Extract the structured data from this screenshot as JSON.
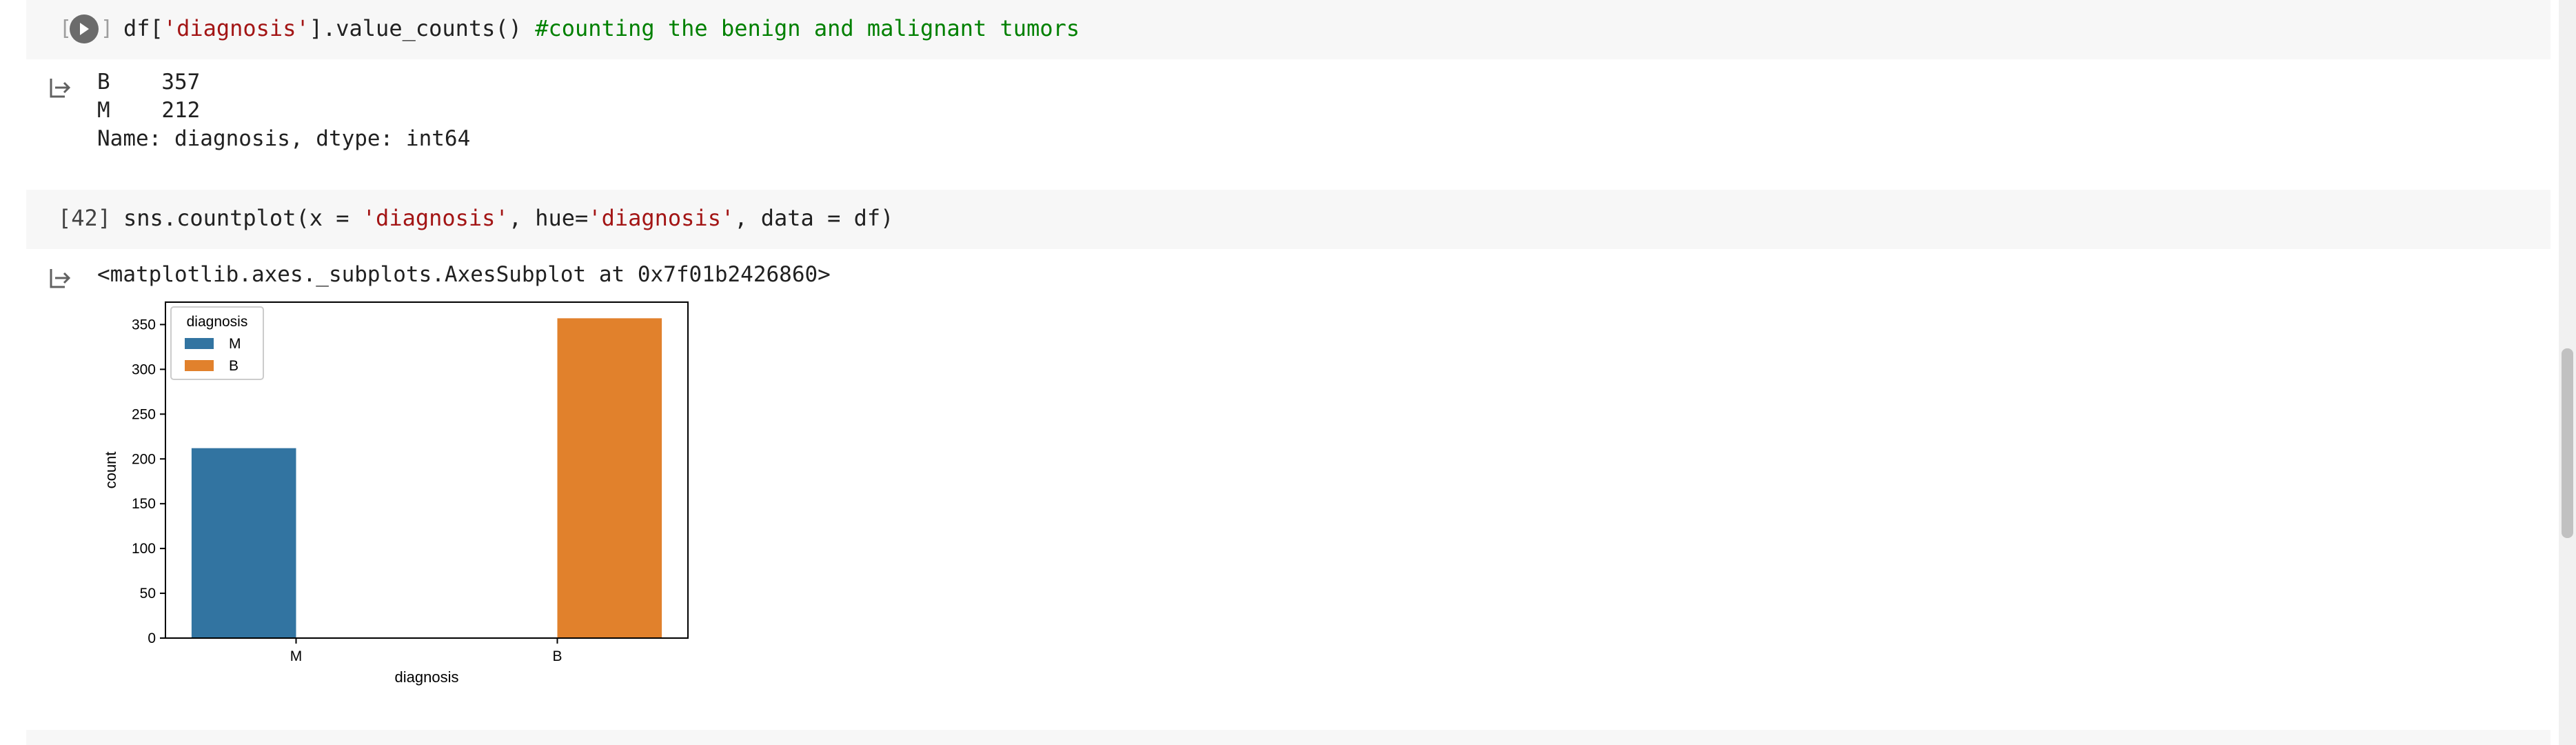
{
  "cell1": {
    "code_tokens": [
      {
        "t": "df[",
        "c": "plain"
      },
      {
        "t": "'diagnosis'",
        "c": "str"
      },
      {
        "t": "].value_counts() ",
        "c": "plain"
      },
      {
        "t": "#counting the benign and malignant tumors",
        "c": "com"
      }
    ],
    "output_lines": [
      "B    357",
      "M    212",
      "Name: diagnosis, dtype: int64"
    ]
  },
  "cell2": {
    "exec_count": "[42]",
    "code_tokens": [
      {
        "t": "sns.countplot(x = ",
        "c": "plain"
      },
      {
        "t": "'diagnosis'",
        "c": "str"
      },
      {
        "t": ", hue=",
        "c": "plain"
      },
      {
        "t": "'diagnosis'",
        "c": "str"
      },
      {
        "t": ", data = df)",
        "c": "plain"
      }
    ],
    "output_repr": "<matplotlib.axes._subplots.AxesSubplot at 0x7f01b2426860>"
  },
  "colors": {
    "series_m": "#3274a1",
    "series_b": "#e1812c",
    "string": "#a31515",
    "comment": "#008000"
  },
  "chart_data": {
    "type": "bar",
    "categories": [
      "M",
      "B"
    ],
    "series": [
      {
        "name": "M",
        "values": [
          212,
          null
        ]
      },
      {
        "name": "B",
        "values": [
          null,
          357
        ]
      }
    ],
    "xlabel": "diagnosis",
    "ylabel": "count",
    "ylim": [
      0,
      375
    ],
    "yticks": [
      0,
      50,
      100,
      150,
      200,
      250,
      300,
      350
    ],
    "legend": {
      "title": "diagnosis",
      "entries": [
        "M",
        "B"
      ],
      "placement": "top-left"
    }
  }
}
